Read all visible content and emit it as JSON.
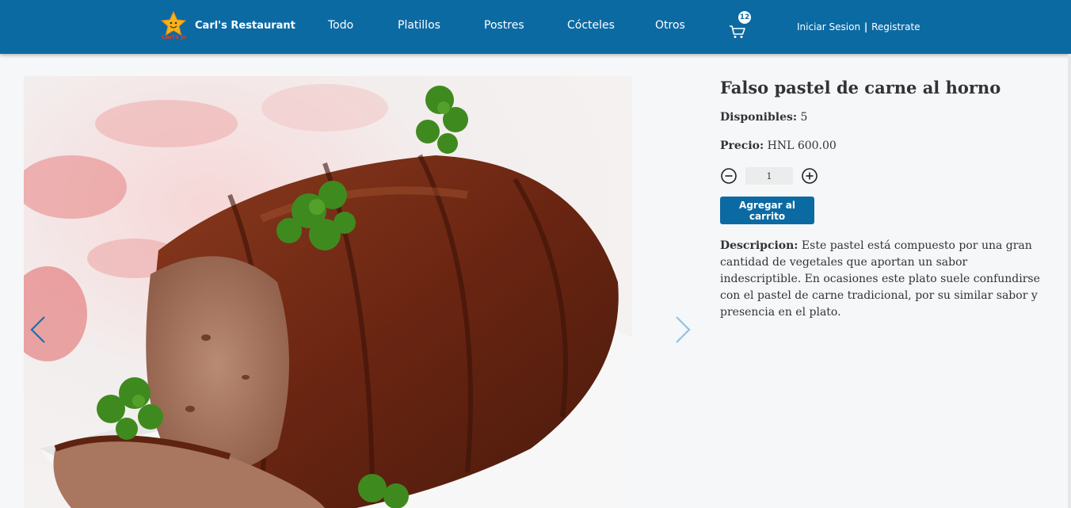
{
  "navbar": {
    "logo_text": "Carl's Jr.",
    "brand_name": "Carl's Restaurant",
    "links": [
      "Todo",
      "Platillos",
      "Postres",
      "Cócteles",
      "Otros"
    ],
    "cart_count": "12",
    "login": "Iniciar Sesion",
    "separator": "|",
    "register": "Registrate",
    "color": "#0c6aa3"
  },
  "product": {
    "title": "Falso pastel de carne al horno",
    "available_label": "Disponibles:",
    "available_value": "5",
    "price_label": "Precio:",
    "price_value": "HNL 600.00",
    "quantity": "1",
    "add_button": "Agregar al carrito",
    "description_label": "Descripcion:",
    "description_text": "Este pastel está compuesto por una gran cantidad de vegetales que aportan un sabor indescriptible. En ocasiones este plato suele confundirse con el pastel de carne tradicional, por su similar sabor y presencia en el plato."
  },
  "icons": {
    "prev": "chevron-left-icon",
    "next": "chevron-right-icon",
    "cart": "shopping-cart-icon",
    "minus": "minus-circle-icon",
    "plus": "plus-circle-icon",
    "logo": "star-icon"
  }
}
